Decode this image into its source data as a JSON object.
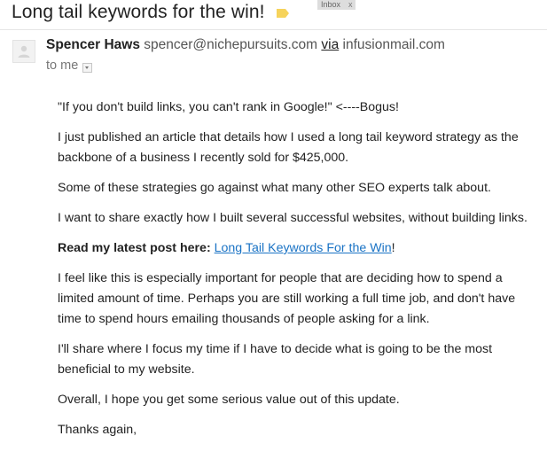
{
  "email": {
    "subject": "Long tail keywords for the win!",
    "label_chip": "Inbox",
    "label_chip_close": "x",
    "label_tag_color": "#f6d35b",
    "sender_name": "Spencer Haws",
    "sender_email": "spencer@nichepursuits.com",
    "via_text": "via",
    "via_domain": "infusionmail.com",
    "recipient": "to me"
  },
  "body": {
    "p1": "\"If you don't build links, you can't rank in Google!\" <----Bogus!",
    "p2": "I just published an article that details how I used a long tail keyword strategy as the backbone of a business I recently sold for $425,000.",
    "p3": "Some of these strategies go against what many other SEO experts talk about.",
    "p4": "I want to share exactly how I built several successful websites, without building links.",
    "p5_label": "Read my latest post here:",
    "p5_link": "Long Tail Keywords For the Win",
    "p5_suffix": "!",
    "p6": "I feel like this is especially important for people that are deciding how to spend a limited amount of time. Perhaps you are still working a full time job, and don't have time to spend hours emailing thousands of people asking for a link.",
    "p7": "I'll share where I focus my time if I have to decide what is going to be the most beneficial to my website.",
    "p8": "Overall, I hope you get some serious value out of this update.",
    "p9": "Thanks again,"
  },
  "colors": {
    "link": "#1a73c5",
    "chip_bg": "#dddddd",
    "label_tag": "#f6d35b"
  }
}
